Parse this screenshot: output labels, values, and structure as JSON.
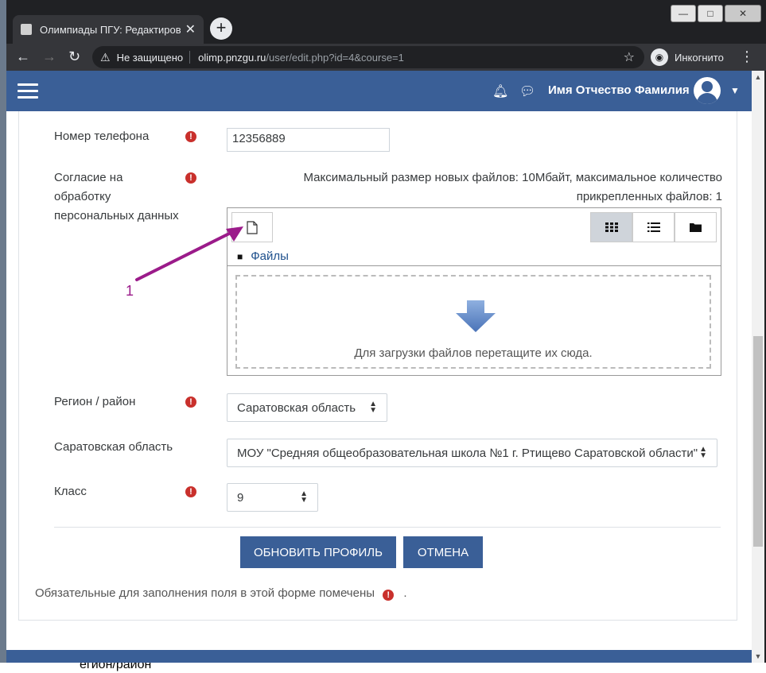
{
  "browser": {
    "tab_title": "Олимпиады ПГУ: Редактировать",
    "security_label": "Не защищено",
    "url_host": "olimp.pnzgu.ru",
    "url_path": "/user/edit.php?id=4&course=1",
    "incognito_label": "Инкогнито"
  },
  "header": {
    "user_name": "Имя Отчество Фамилия"
  },
  "form": {
    "phone": {
      "label": "Номер телефона",
      "value": "12356889"
    },
    "consent": {
      "label_lines": [
        "Согласие на",
        "обработку",
        "персональных данных"
      ],
      "file_info_line1": "Максимальный размер новых файлов: 10Мбайт, максимальное количество",
      "file_info_line2": "прикрепленных файлов: 1",
      "path_label": "Файлы",
      "drop_text": "Для загрузки файлов перетащите их сюда."
    },
    "region": {
      "label": "Регион / район",
      "value": "Саратовская область"
    },
    "school": {
      "label": "Саратовская область",
      "value": "МОУ \"Средняя общеобразовательная школа №1 г. Ртищево Саратовской области\""
    },
    "grade": {
      "label": "Класс",
      "value": "9"
    },
    "update_button": "ОБНОВИТЬ ПРОФИЛЬ",
    "cancel_button": "ОТМЕНА",
    "required_note": "Обязательные для заполнения поля в этой форме помечены",
    "required_note_end": "."
  },
  "annotation": {
    "number": "1"
  },
  "bottom_text": "егион/район",
  "colors": {
    "brand": "#3a5f97",
    "required": "#c9302c",
    "annotation": "#9b1b8a"
  }
}
